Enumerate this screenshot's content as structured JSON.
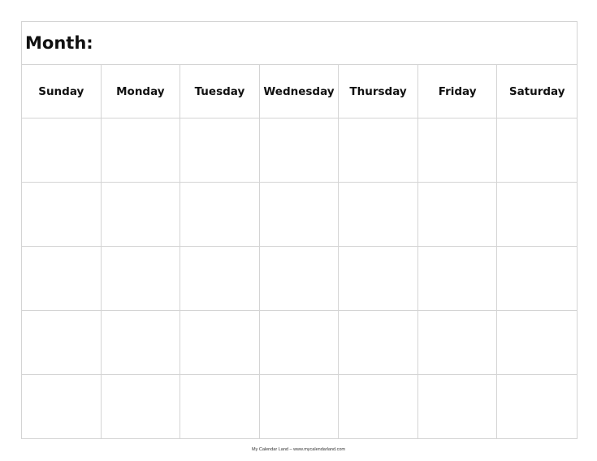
{
  "calendar": {
    "month_label": "Month:",
    "days": [
      "Sunday",
      "Monday",
      "Tuesday",
      "Wednesday",
      "Thursday",
      "Friday",
      "Saturday"
    ],
    "weeks": 5,
    "cells": [
      [
        "",
        "",
        "",
        "",
        "",
        "",
        ""
      ],
      [
        "",
        "",
        "",
        "",
        "",
        "",
        ""
      ],
      [
        "",
        "",
        "",
        "",
        "",
        "",
        ""
      ],
      [
        "",
        "",
        "",
        "",
        "",
        "",
        ""
      ],
      [
        "",
        "",
        "",
        "",
        "",
        "",
        ""
      ]
    ]
  },
  "footer": {
    "text": "My Calendar Land – www.mycalendarland.com"
  }
}
